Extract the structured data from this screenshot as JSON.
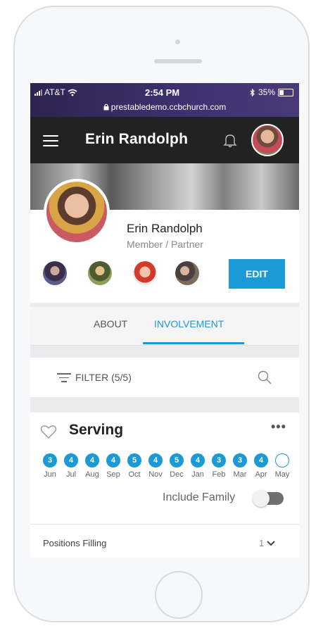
{
  "status_bar": {
    "carrier": "AT&T",
    "time": "2:54 PM",
    "battery": "35%",
    "url": "prestabledemo.ccbchurch.com"
  },
  "header": {
    "title": "Erin Randolph"
  },
  "profile": {
    "name": "Erin Randolph",
    "role": "Member / Partner",
    "edit_label": "EDIT",
    "family_count": 4
  },
  "tabs": [
    {
      "label": "ABOUT",
      "active": false
    },
    {
      "label": "INVOLVEMENT",
      "active": true
    }
  ],
  "filter": {
    "label": "FILTER (5/5)"
  },
  "serving": {
    "title": "Serving",
    "more_label": "•••",
    "months": [
      {
        "label": "Jun",
        "count": "3"
      },
      {
        "label": "Jul",
        "count": "4"
      },
      {
        "label": "Aug",
        "count": "4"
      },
      {
        "label": "Sep",
        "count": "4"
      },
      {
        "label": "Oct",
        "count": "5"
      },
      {
        "label": "Nov",
        "count": "4"
      },
      {
        "label": "Dec",
        "count": "5"
      },
      {
        "label": "Jan",
        "count": "4"
      },
      {
        "label": "Feb",
        "count": "3"
      },
      {
        "label": "Mar",
        "count": "3"
      },
      {
        "label": "Apr",
        "count": "4"
      },
      {
        "label": "May",
        "count": ""
      }
    ],
    "include_family_label": "Include Family",
    "include_family_on": false
  },
  "positions": {
    "label": "Positions Filling",
    "count": "1"
  },
  "colors": {
    "accent": "#1a9ad6",
    "header_bg": "#222222",
    "status_bg": "#3a2f68"
  }
}
